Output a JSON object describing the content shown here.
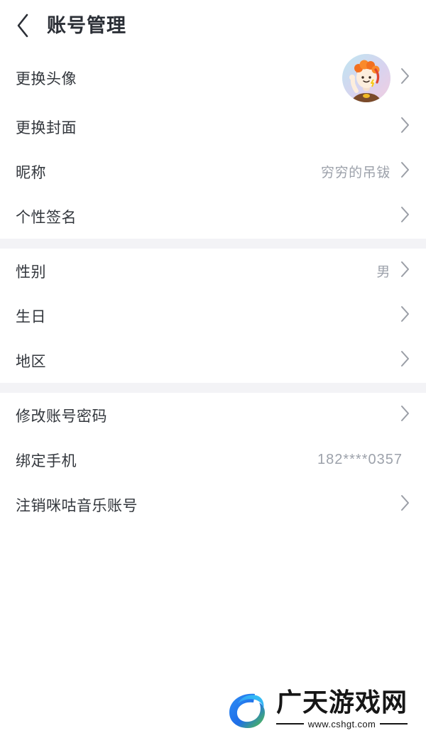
{
  "header": {
    "title": "账号管理",
    "back_icon": "chevron-left-icon"
  },
  "groups": [
    {
      "rows": [
        {
          "label": "更换头像",
          "value": "",
          "icon": "avatar-image",
          "chevron": true
        },
        {
          "label": "更换封面",
          "value": "",
          "chevron": true
        },
        {
          "label": "昵称",
          "value": "穷穷的吊钹",
          "chevron": true
        },
        {
          "label": "个性签名",
          "value": "",
          "chevron": true
        }
      ]
    },
    {
      "rows": [
        {
          "label": "性别",
          "value": "男",
          "chevron": true
        },
        {
          "label": "生日",
          "value": "",
          "chevron": true
        },
        {
          "label": "地区",
          "value": "",
          "chevron": true
        }
      ]
    },
    {
      "rows": [
        {
          "label": "修改账号密码",
          "value": "",
          "chevron": true
        },
        {
          "label": "绑定手机",
          "value": "182****0357",
          "chevron": false
        },
        {
          "label": "注销咪咕音乐账号",
          "value": "",
          "chevron": true
        }
      ]
    }
  ],
  "rows": {
    "avatar": {
      "label": "更换头像",
      "value": ""
    },
    "cover": {
      "label": "更换封面",
      "value": ""
    },
    "nickname": {
      "label": "昵称",
      "value": "穷穷的吊钹"
    },
    "signature": {
      "label": "个性签名",
      "value": ""
    },
    "gender": {
      "label": "性别",
      "value": "男"
    },
    "birthday": {
      "label": "生日",
      "value": ""
    },
    "region": {
      "label": "地区",
      "value": ""
    },
    "password": {
      "label": "修改账号密码",
      "value": ""
    },
    "phone": {
      "label": "绑定手机",
      "value": "182****0357"
    },
    "delete_account": {
      "label": "注销咪咕音乐账号",
      "value": ""
    }
  },
  "watermark": {
    "name": "广天游戏网",
    "url": "www.cshgt.com",
    "logo_icon": "g-logo-icon"
  },
  "colors": {
    "page_background": "#ffffff",
    "group_separator": "#f3f3f6",
    "label_text": "#33373d",
    "value_text": "#9da2ab",
    "chevron": "#9a9ea6",
    "title_text": "#2b2f36",
    "watermark_text": "#161616",
    "logo_blue": "#1a7ef0",
    "logo_cyan": "#35c6f4",
    "logo_green": "#56c63c"
  }
}
